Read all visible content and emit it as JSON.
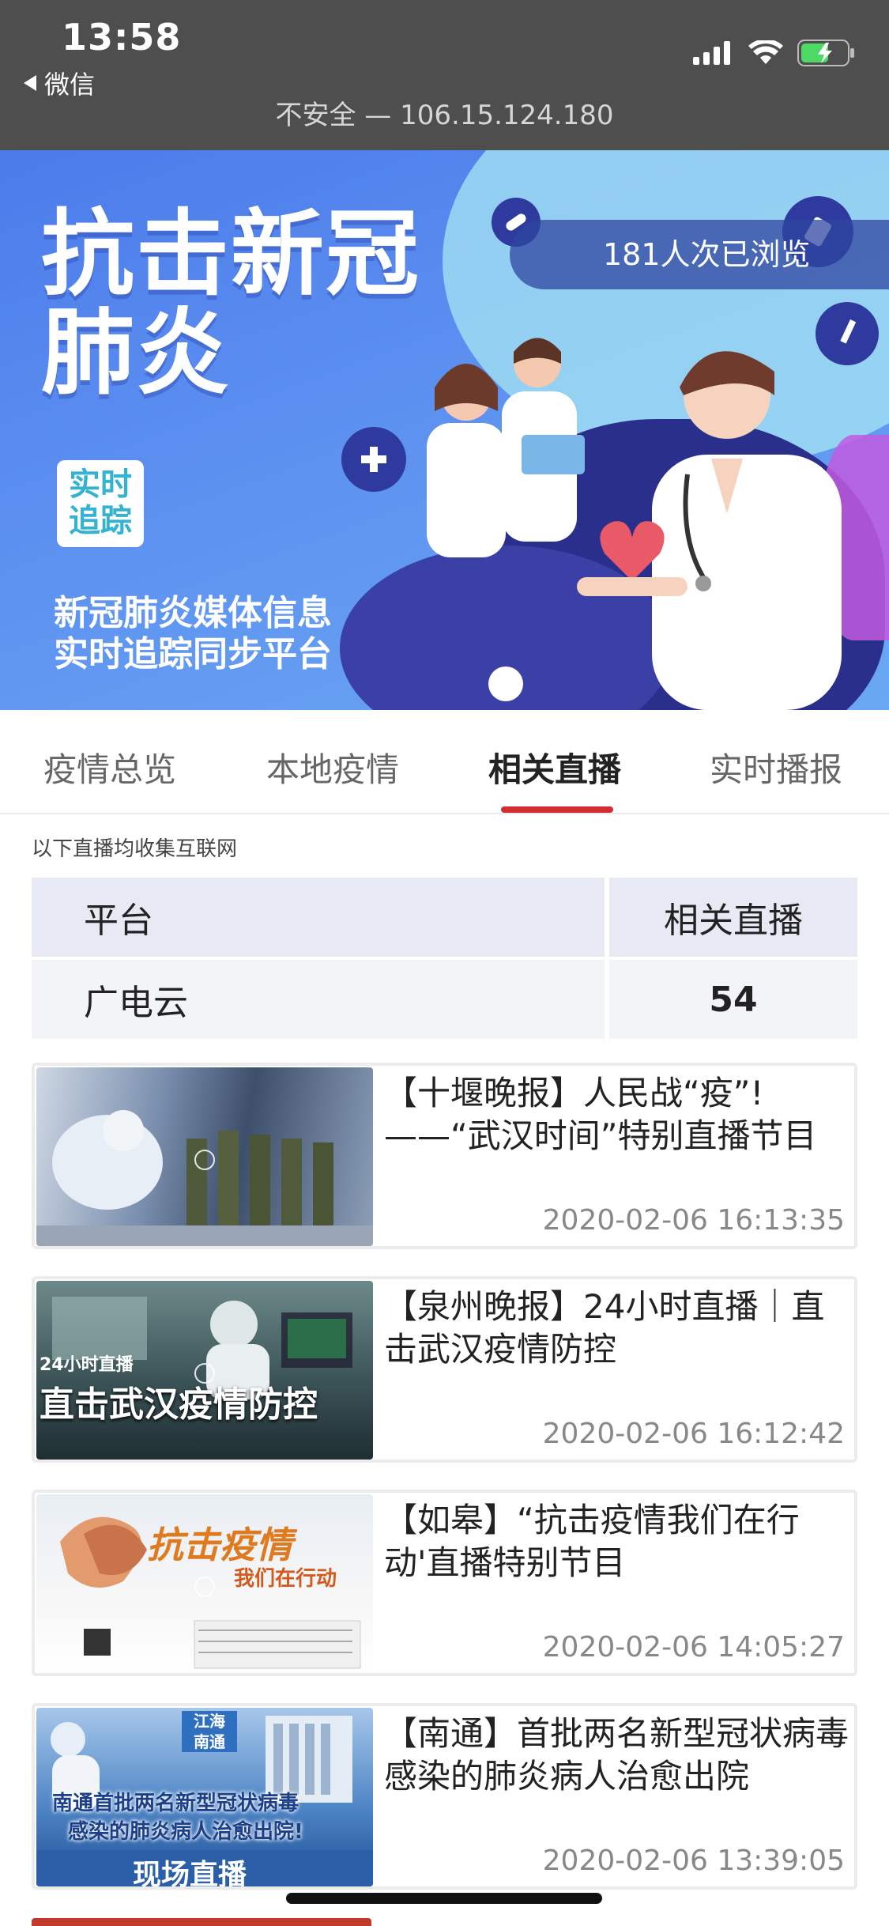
{
  "status_bar": {
    "time": "13:58",
    "back_label": "微信",
    "url": "不安全 — 106.15.124.180"
  },
  "banner": {
    "title_line1": "抗击新冠",
    "title_line2": "肺炎",
    "tag_line1": "实时",
    "tag_line2": "追踪",
    "subtitle_line1": "新冠肺炎媒体信息",
    "subtitle_line2": "实时追踪同步平台",
    "views": "181人次已浏览"
  },
  "tabs": [
    {
      "label": "疫情总览",
      "active": false
    },
    {
      "label": "本地疫情",
      "active": false
    },
    {
      "label": "相关直播",
      "active": true
    },
    {
      "label": "实时播报",
      "active": false
    }
  ],
  "note": "以下直播均收集互联网",
  "table": {
    "headers": [
      "平台",
      "相关直播"
    ],
    "rows": [
      [
        "广电云",
        "54"
      ]
    ]
  },
  "news": [
    {
      "title": "【十堰晚报】人民战“疫”!——“武汉时间”特别直播节目",
      "date": "2020-02-06 16:13:35"
    },
    {
      "title": "【泉州晚报】24小时直播｜直击武汉疫情防控",
      "date": "2020-02-06 16:12:42",
      "thumb_caption_small": "24小时直播",
      "thumb_caption": "直击武汉疫情防控"
    },
    {
      "title": "【如皋】“抗击疫情我们在行动'直播特别节目",
      "date": "2020-02-06 14:05:27",
      "thumb_caption": "抗击疫情",
      "thumb_caption_sub": "我们在行动"
    },
    {
      "title": "【南通】首批两名新型冠状病毒感染的肺炎病人治愈出院",
      "date": "2020-02-06 13:39:05",
      "thumb_badge": "江海\n南通",
      "thumb_caption_1": "南通首批两名新型冠状病毒",
      "thumb_caption_2": "感染的肺炎病人治愈出院!",
      "thumb_caption_3": "现场直播"
    }
  ],
  "colors": {
    "accent_red": "#d32d32",
    "banner_blue": "#5b8ef0"
  }
}
